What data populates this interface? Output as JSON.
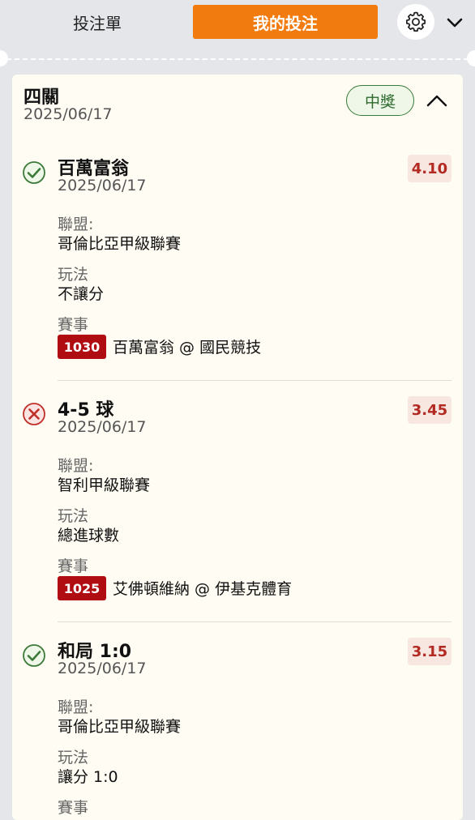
{
  "tabs": {
    "betslip_label": "投注單",
    "mybets_label": "我的投注"
  },
  "icons": {
    "settings": "gear-icon",
    "dropdown": "chevron-down-icon",
    "collapse": "chevron-up-icon",
    "won": "check-circle-icon",
    "lost": "x-circle-icon"
  },
  "colors": {
    "accent": "#f27b0f",
    "won": "#3d7a3a",
    "lost": "#c0302a",
    "odds": "#b32a22",
    "match_no_bg": "#b00d12"
  },
  "bet": {
    "title": "四關",
    "date": "2025/06/17",
    "status": "中獎",
    "legs": [
      {
        "result": "won",
        "selection": "百萬富翁",
        "date": "2025/06/17",
        "odds": "4.10",
        "league_label": "聯盟:",
        "league": "哥倫比亞甲級聯賽",
        "market_label": "玩法",
        "market": "不讓分",
        "event_label": "賽事",
        "match_no": "1030",
        "match": "百萬富翁 @ 國民競技"
      },
      {
        "result": "lost",
        "selection": "4-5 球",
        "date": "2025/06/17",
        "odds": "3.45",
        "league_label": "聯盟:",
        "league": "智利甲級聯賽",
        "market_label": "玩法",
        "market": "總進球數",
        "event_label": "賽事",
        "match_no": "1025",
        "match": "艾佛頓維納 @ 伊基克體育"
      },
      {
        "result": "won",
        "selection": "和局 1:0",
        "date": "2025/06/17",
        "odds": "3.15",
        "league_label": "聯盟:",
        "league": "哥倫比亞甲級聯賽",
        "market_label": "玩法",
        "market": "讓分 1:0",
        "event_label": "賽事"
      }
    ]
  }
}
